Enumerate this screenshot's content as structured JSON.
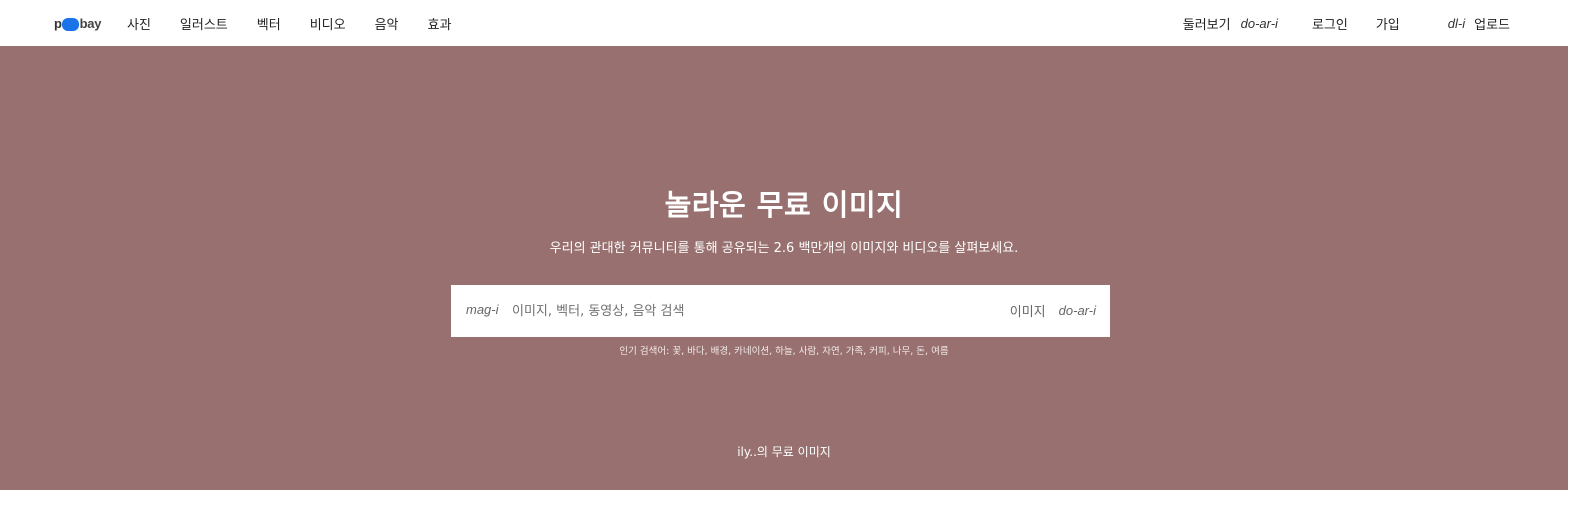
{
  "brand": {
    "logo_text_start": "p",
    "logo_text_end": "bay",
    "accent_color": "#1a73e8"
  },
  "nav": {
    "left": [
      "사진",
      "일러스트",
      "벡터",
      "비디오",
      "음악",
      "효과"
    ],
    "explore_label": "둘러보기",
    "explore_icon_alt": "do-ar-i",
    "login_label": "로그인",
    "join_label": "가입",
    "upload_icon_alt": "dl-i",
    "upload_label": "업로드"
  },
  "hero": {
    "background_color": "#97706f",
    "title": "놀라운 무료 이미지",
    "subtitle": "우리의 관대한 커뮤니티를 통해 공유되는 2.6 백만개의 이미지와 비디오를 살펴보세요.",
    "search": {
      "icon_alt": "mag-i",
      "placeholder": "이미지, 벡터, 동영상, 음악 검색",
      "value": "",
      "type_label": "이미지",
      "type_icon_alt": "do-ar-i"
    },
    "popular": "인기 검색어: 꽃, 바다, 배경, 카네이션, 하늘, 사람, 자연, 가족, 커피, 나무, 돈, 여름",
    "credit": "ily..의 무료 이미지"
  }
}
